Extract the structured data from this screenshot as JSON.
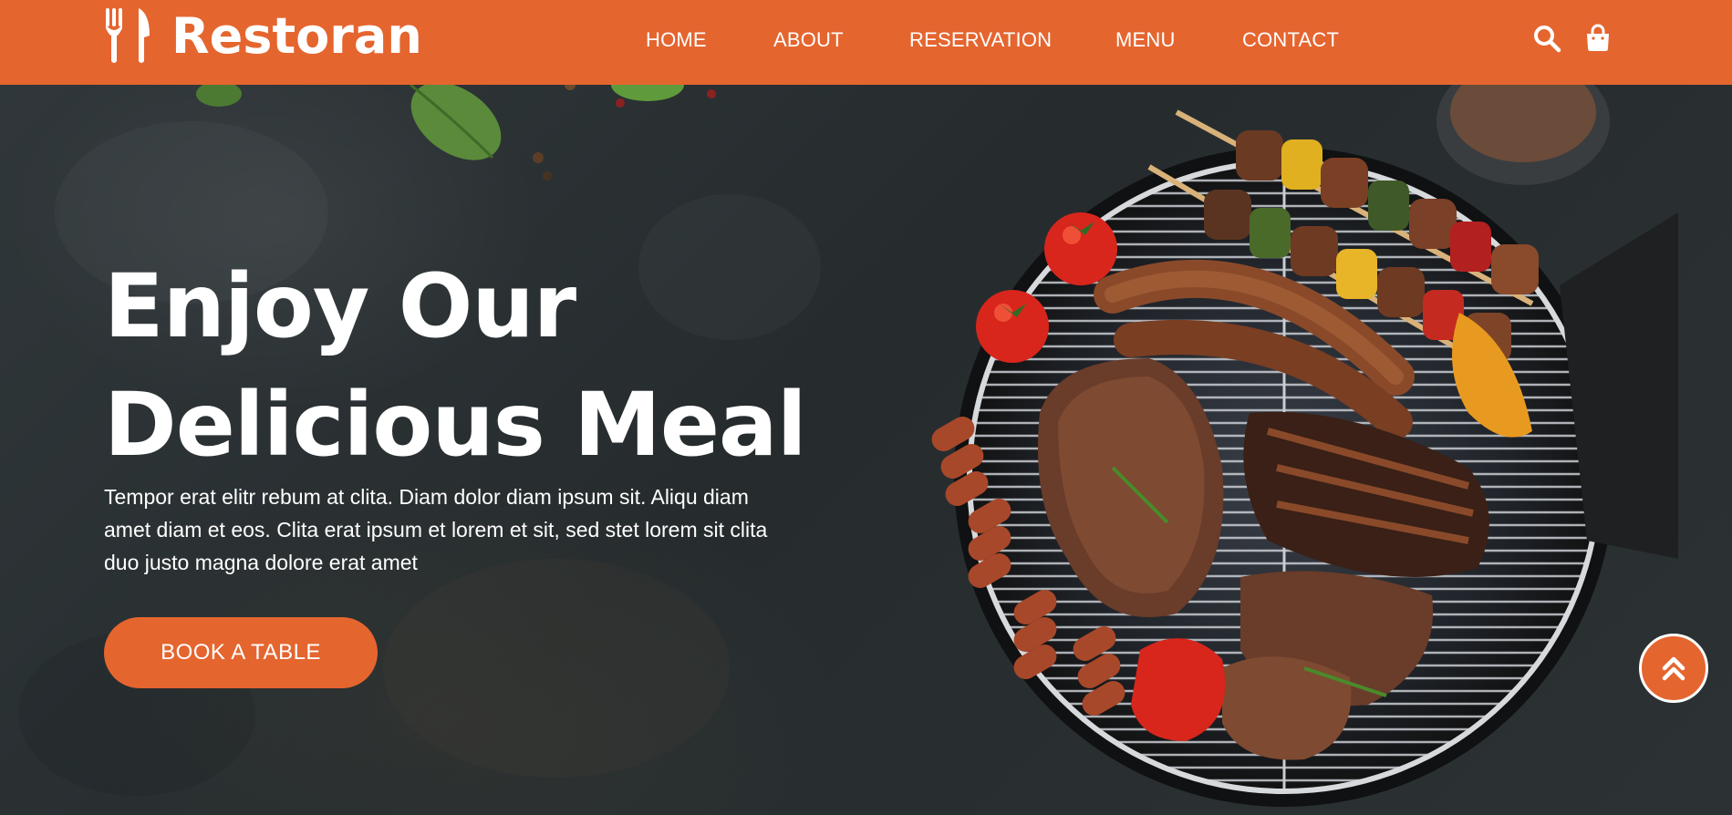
{
  "brand": {
    "name": "Restoran",
    "icon": "utensils-icon"
  },
  "nav": {
    "items": [
      {
        "label": "HOME"
      },
      {
        "label": "ABOUT"
      },
      {
        "label": "RESERVATION"
      },
      {
        "label": "MENU"
      },
      {
        "label": "CONTACT"
      }
    ],
    "search_icon": "search-icon",
    "cart_icon": "shopping-bag-icon"
  },
  "hero": {
    "title_line1": "Enjoy Our",
    "title_line2": "Delicious Meal",
    "description": "Tempor erat elitr rebum at clita. Diam dolor diam ipsum sit. Aliqu diam amet diam et eos. Clita erat ipsum et lorem et sit, sed stet lorem sit clita duo justo magna dolore erat amet",
    "cta_label": "BOOK A TABLE",
    "image": "barbecue-grill-image"
  },
  "back_to_top_icon": "double-chevron-up-icon",
  "colors": {
    "primary": "#E5652F",
    "background": "#2a3033",
    "text": "#FFFFFF"
  }
}
